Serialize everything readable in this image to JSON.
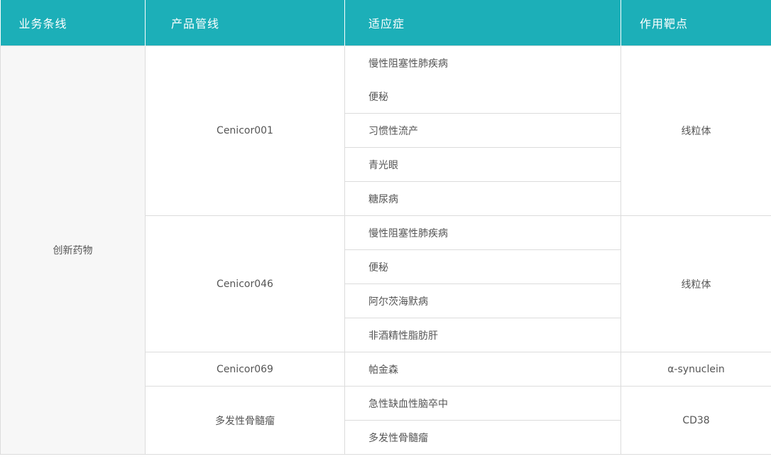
{
  "headers": [
    "业务条线",
    "产品管线",
    "适应症",
    "作用靶点"
  ],
  "business_line": "创新药物",
  "groups": [
    {
      "product": "Cenicor001",
      "target": "线粒体",
      "indications": [
        "慢性阻塞性肺疾病",
        "便秘",
        "习惯性流产",
        "青光眼",
        "糖尿病"
      ]
    },
    {
      "product": "Cenicor046",
      "target": "线粒体",
      "indications": [
        "慢性阻塞性肺疾病",
        "便秘",
        "阿尔茨海默病",
        "非酒精性脂肪肝"
      ]
    },
    {
      "product": "Cenicor069",
      "target": "α-synuclein",
      "indications": [
        "帕金森"
      ]
    },
    {
      "product": "多发性骨髓瘤",
      "target": "CD38",
      "indications": [
        "急性缺血性脑卒中",
        "多发性骨髓瘤"
      ]
    }
  ],
  "colors": {
    "header_bg": "#1cafb8",
    "header_text": "#ffffff",
    "border": "#dcdcdc",
    "cell_bg_gray": "#f7f7f7"
  }
}
